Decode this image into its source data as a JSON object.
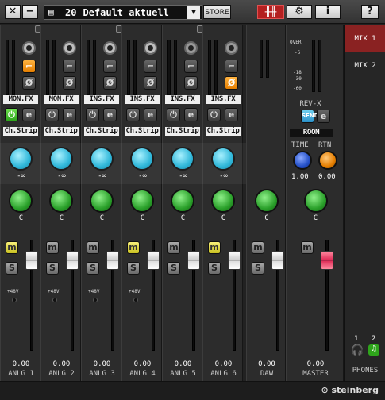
{
  "toolbar": {
    "scene_number": "20",
    "scene_name": "Default aktuell",
    "store_label": "STORE",
    "dropdown_icon": "triangle-down-icon",
    "help_label": "?"
  },
  "channels": [
    {
      "name": "ANLG 1",
      "fx": "MON.FX",
      "strip": "Ch.Strip",
      "pan": "-∞",
      "level": "C",
      "out": "0.00",
      "phantom": "+48V",
      "fx_on": true,
      "pan_icon": "speaker-active",
      "mute_lit": true
    },
    {
      "name": "ANLG 2",
      "fx": "MON.FX",
      "strip": "Ch.Strip",
      "pan": "-∞",
      "level": "C",
      "out": "0.00",
      "phantom": "+48V",
      "fx_on": false,
      "mute_lit": false
    },
    {
      "name": "ANLG 3",
      "fx": "INS.FX",
      "strip": "Ch.Strip",
      "pan": "-∞",
      "level": "C",
      "out": "0.00",
      "phantom": "+48V",
      "fx_on": false,
      "mute_lit": false
    },
    {
      "name": "ANLG 4",
      "fx": "INS.FX",
      "strip": "Ch.Strip",
      "pan": "-∞",
      "level": "C",
      "out": "0.00",
      "phantom": "+48V",
      "fx_on": false,
      "mute_lit": true
    },
    {
      "name": "ANLG 5",
      "fx": "INS.FX",
      "strip": "Ch.Strip",
      "pan": "-∞",
      "level": "C",
      "out": "0.00",
      "phantom": "",
      "fx_on": false,
      "mute_lit": false
    },
    {
      "name": "ANLG 6",
      "fx": "INS.FX",
      "strip": "Ch.Strip",
      "pan": "-∞",
      "level": "C",
      "out": "0.00",
      "phantom": "",
      "fx_on": false,
      "mute_lit": true
    }
  ],
  "daw": {
    "name": "DAW",
    "level": "C",
    "out": "0.00"
  },
  "master": {
    "name": "MASTER",
    "fx_label": "REV-X",
    "room": "ROOM",
    "time_label": "TIME",
    "rtn_label": "RTN",
    "time_val": "1.00",
    "rtn_val": "0.00",
    "out": "0.00",
    "level": "C",
    "meter_scale": [
      "OVER",
      "-6",
      "-18",
      "-30",
      "-60"
    ],
    "send_label": "SEND"
  },
  "mix": {
    "items": [
      "MIX 1",
      "MIX 2"
    ],
    "phones_label": "PHONES",
    "phones_nums": [
      "1",
      "2"
    ]
  },
  "brand": "steinberg",
  "colors": {
    "accent": "#8a2222",
    "cyan": "#25b4d8",
    "green": "#2aa02a"
  }
}
